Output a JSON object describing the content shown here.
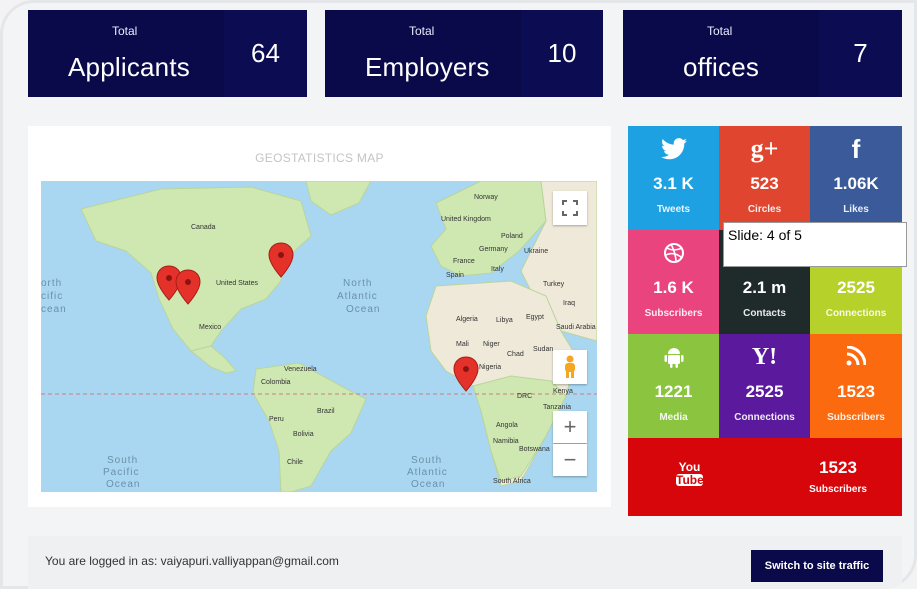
{
  "stats": [
    {
      "small": "Total",
      "label": "Applicants",
      "value": "64"
    },
    {
      "small": "Total",
      "label": "Employers",
      "value": "10"
    },
    {
      "small": "Total",
      "label": "offices",
      "value": "7"
    }
  ],
  "map": {
    "title": "GEOSTATISTICS MAP",
    "oceans": [
      "North Atlantic Ocean",
      "South Pacific Ocean",
      "South Atlantic Ocean",
      "North Pacific Ocean"
    ],
    "labels": [
      "Canada",
      "United States",
      "Mexico",
      "Venezuela",
      "Colombia",
      "Peru",
      "Brazil",
      "Bolivia",
      "Chile",
      "Norway",
      "United Kingdom",
      "Poland",
      "Germany",
      "Ukraine",
      "France",
      "Spain",
      "Italy",
      "Turkey",
      "Iraq",
      "Algeria",
      "Libya",
      "Egypt",
      "Saudi Arabia",
      "Mali",
      "Niger",
      "Chad",
      "Sudan",
      "Nigeria",
      "Kenya",
      "DRC",
      "Tanzania",
      "Angola",
      "Namibia",
      "Botswana",
      "South Africa"
    ],
    "markers": [
      "us-west-marker-1",
      "us-west-marker-2",
      "us-east-marker",
      "west-africa-marker"
    ],
    "controls": {
      "fullscreen": "fullscreen-icon",
      "pegman": "pegman-icon",
      "zoom_in": "+",
      "zoom_out": "−"
    }
  },
  "social": [
    {
      "name": "twitter",
      "icon": "twitter-icon",
      "value": "3.1 K",
      "label": "Tweets",
      "color": "#1da1e2"
    },
    {
      "name": "googleplus",
      "icon": "g+",
      "value": "523",
      "label": "Circles",
      "color": "#e0452f"
    },
    {
      "name": "facebook",
      "icon": "f",
      "value": "1.06K",
      "label": "Likes",
      "color": "#3b5a9a"
    },
    {
      "name": "dribbble",
      "icon": "dribbble-icon",
      "value": "1.6 K",
      "label": "Subscribers",
      "color": "#e9447d"
    },
    {
      "name": "contacts",
      "icon": "contacts-icon",
      "value": "2.1 m",
      "label": "Contacts",
      "color": "#1f2a2a"
    },
    {
      "name": "connections-green",
      "icon": "link-icon",
      "value": "2525",
      "label": "Connections",
      "color": "#b5d12a"
    },
    {
      "name": "android",
      "icon": "android-icon",
      "value": "1221",
      "label": "Media",
      "color": "#8bc540"
    },
    {
      "name": "yahoo",
      "icon": "Y!",
      "value": "2525",
      "label": "Connections",
      "color": "#5b1a9e"
    },
    {
      "name": "rss",
      "icon": "rss-icon",
      "value": "1523",
      "label": "Subscribers",
      "color": "#fb6a0f"
    },
    {
      "name": "youtube",
      "icon": "You Tube",
      "value": "1523",
      "label": "Subscribers",
      "color": "#d6060a"
    }
  ],
  "tooltip": "Slide: 4 of 5",
  "footer": {
    "logged_in": "You are logged in as: vaiyapuri.valliyappan@gmail.com",
    "switch_label": "Switch to site traffic"
  }
}
